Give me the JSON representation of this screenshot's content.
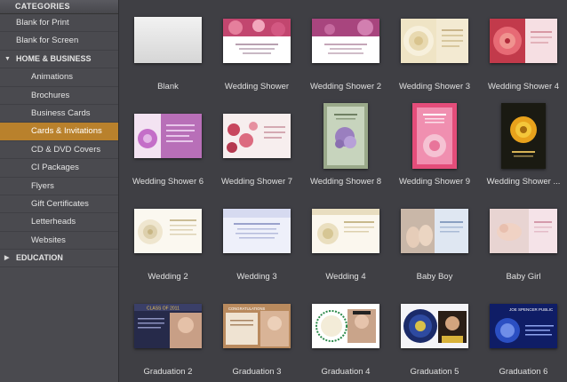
{
  "sidebar": {
    "header": "CATEGORIES",
    "items": [
      {
        "label": "Blank for Print"
      },
      {
        "label": "Blank for Screen"
      },
      {
        "label": "HOME & BUSINESS"
      },
      {
        "label": "Animations"
      },
      {
        "label": "Brochures"
      },
      {
        "label": "Business Cards"
      },
      {
        "label": "Cards & Invitations"
      },
      {
        "label": "CD & DVD Covers"
      },
      {
        "label": "CI Packages"
      },
      {
        "label": "Flyers"
      },
      {
        "label": "Gift Certificates"
      },
      {
        "label": "Letterheads"
      },
      {
        "label": "Websites"
      },
      {
        "label": "EDUCATION"
      }
    ]
  },
  "templates": [
    {
      "name": "Blank"
    },
    {
      "name": "Wedding Shower"
    },
    {
      "name": "Wedding Shower 2"
    },
    {
      "name": "Wedding Shower 3"
    },
    {
      "name": "Wedding Shower 4"
    },
    {
      "name": "Wedding Shower 6"
    },
    {
      "name": "Wedding Shower 7"
    },
    {
      "name": "Wedding Shower 8"
    },
    {
      "name": "Wedding Shower 9"
    },
    {
      "name": "Wedding Shower ..."
    },
    {
      "name": "Wedding 2"
    },
    {
      "name": "Wedding 3"
    },
    {
      "name": "Wedding 4"
    },
    {
      "name": "Baby Boy"
    },
    {
      "name": "Baby Girl"
    },
    {
      "name": "Graduation 2"
    },
    {
      "name": "Graduation 3"
    },
    {
      "name": "Graduation 4"
    },
    {
      "name": "Graduation 5"
    },
    {
      "name": "Graduation 6"
    }
  ],
  "thumb_text": {
    "grad2": "CLASS OF 2011",
    "grad3": "CONGRATULATIONS",
    "grad6": "JOE SPENCER PUBLIC"
  }
}
